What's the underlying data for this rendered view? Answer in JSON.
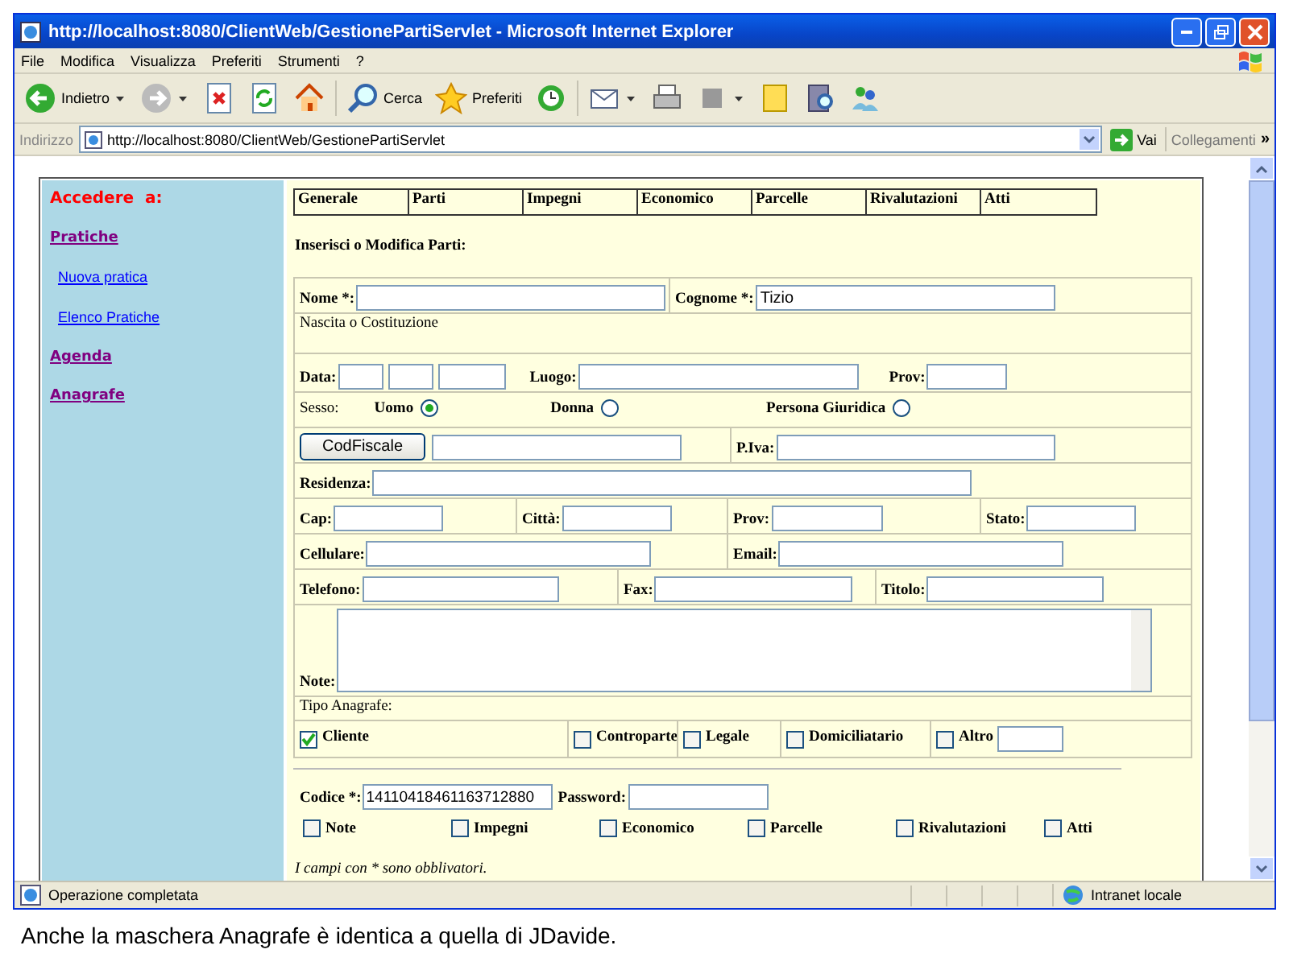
{
  "window": {
    "title": "http://localhost:8080/ClientWeb/GestionePartiServlet - Microsoft Internet Explorer"
  },
  "menu_bar": [
    "File",
    "Modifica",
    "Visualizza",
    "Preferiti",
    "Strumenti",
    "?"
  ],
  "toolbar": [
    {
      "kind": "back",
      "label": "Indietro",
      "caret": true
    },
    {
      "kind": "forward",
      "caret": true
    },
    {
      "kind": "stop"
    },
    {
      "kind": "refresh"
    },
    {
      "kind": "home"
    },
    {
      "kind": "search",
      "label": "Cerca"
    },
    {
      "kind": "favorites",
      "label": "Preferiti"
    },
    {
      "kind": "history"
    },
    {
      "kind": "mail",
      "caret": true
    },
    {
      "kind": "print"
    },
    {
      "kind": "edit",
      "caret": true
    },
    {
      "kind": "note"
    },
    {
      "kind": "research"
    },
    {
      "kind": "messenger"
    }
  ],
  "address_bar": {
    "label": "Indirizzo",
    "url": "http://localhost:8080/ClientWeb/GestionePartiServlet",
    "go_button": "Vai",
    "links_label": "Collegamenti",
    "more": "»"
  },
  "sidebar": {
    "heading": "Accedere  a:",
    "items": [
      {
        "kind": "section",
        "label": "Pratiche"
      },
      {
        "kind": "link",
        "label": "Nuova pratica"
      },
      {
        "kind": "link",
        "label": "Elenco Pratiche"
      },
      {
        "kind": "section",
        "label": "Agenda"
      },
      {
        "kind": "section",
        "label": "Anagrafe"
      }
    ]
  },
  "tabs": [
    "Generale",
    "Parti",
    "Impegni",
    "Economico",
    "Parcelle",
    "Rivalutazioni",
    "Atti"
  ],
  "form": {
    "heading": "Inserisci o Modifica Parti:",
    "rows": [
      [
        [
          {
            "kind": "field",
            "label": "Nome *:"
          }
        ],
        [
          {
            "kind": "field",
            "label": "Cognome *:",
            "value": "Tizio"
          }
        ]
      ],
      [
        [
          {
            "kind": "text",
            "text": "Nascita o Costituzione"
          }
        ]
      ],
      [
        [
          {
            "kind": "field",
            "label": "Data:"
          },
          {
            "kind": "field"
          },
          {
            "kind": "field"
          },
          {
            "kind": "field",
            "label": "Luogo:"
          },
          {
            "kind": "field",
            "label": "Prov:"
          }
        ]
      ],
      [
        [
          {
            "kind": "text",
            "text": "Sesso:"
          },
          {
            "kind": "radio",
            "label": "Uomo",
            "selected": true
          },
          {
            "kind": "radio",
            "label": "Donna",
            "selected": false
          },
          {
            "kind": "radio",
            "label": "Persona Giuridica",
            "selected": false
          }
        ]
      ],
      [
        [
          {
            "kind": "button",
            "label": "CodFiscale"
          },
          {
            "kind": "field"
          }
        ],
        [
          {
            "kind": "field",
            "label": "P.Iva:"
          }
        ]
      ],
      [
        [
          {
            "kind": "field",
            "label": "Residenza:"
          }
        ]
      ],
      [
        [
          {
            "kind": "field",
            "label": "Cap:"
          }
        ],
        [
          {
            "kind": "field",
            "label": "Città:"
          }
        ],
        [
          {
            "kind": "field",
            "label": "Prov:"
          }
        ],
        [
          {
            "kind": "field",
            "label": "Stato:"
          }
        ]
      ],
      [
        [
          {
            "kind": "field",
            "label": "Cellulare:"
          }
        ],
        [
          {
            "kind": "field",
            "label": "Email:"
          }
        ]
      ],
      [
        [
          {
            "kind": "field",
            "label": "Telefono:"
          }
        ],
        [
          {
            "kind": "field",
            "label": "Fax:"
          }
        ],
        [
          {
            "kind": "field",
            "label": "Titolo:"
          }
        ]
      ],
      [
        [
          {
            "kind": "textarea",
            "label": "Note:"
          }
        ]
      ],
      [
        [
          {
            "kind": "text",
            "text": "Tipo Anagrafe:"
          }
        ]
      ],
      [
        [
          {
            "kind": "checkbox",
            "label": "Cliente",
            "checked": true
          }
        ],
        [
          {
            "kind": "checkbox",
            "label": "Controparte",
            "checked": false
          }
        ],
        [
          {
            "kind": "checkbox",
            "label": "Legale",
            "checked": false
          }
        ],
        [
          {
            "kind": "checkbox",
            "label": "Domiciliatario",
            "checked": false
          }
        ],
        [
          {
            "kind": "checkbox",
            "label": "Altro",
            "checked": false
          },
          {
            "kind": "field"
          }
        ]
      ]
    ]
  },
  "credentials": [
    {
      "kind": "field",
      "label": "Codice *:",
      "value": "14110418461163712880"
    },
    {
      "kind": "field",
      "label": "Password:"
    }
  ],
  "sections": [
    {
      "label": "Note",
      "checked": false
    },
    {
      "label": "Impegni",
      "checked": false
    },
    {
      "label": "Economico",
      "checked": false
    },
    {
      "label": "Parcelle",
      "checked": false
    },
    {
      "label": "Rivalutazioni",
      "checked": false
    },
    {
      "label": "Atti",
      "checked": false
    }
  ],
  "footnote": "I campi con * sono obblivatori.",
  "status_bar": {
    "text": "Operazione completata",
    "zone": "Intranet locale"
  },
  "caption": "Anche la maschera Anagrafe è identica a quella di JDavide."
}
